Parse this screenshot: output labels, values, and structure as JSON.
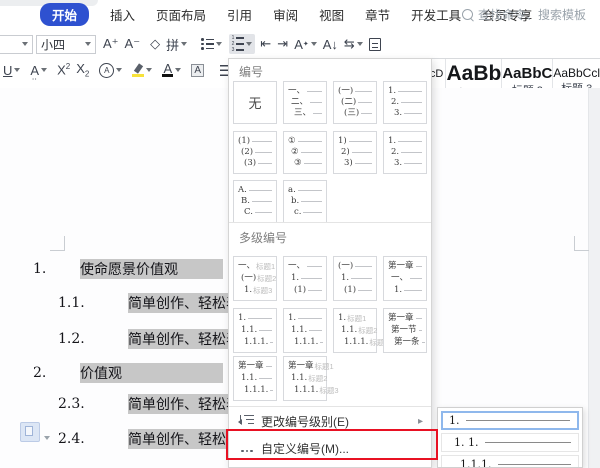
{
  "colors": {
    "accent_blue": "#2e51d0",
    "annotation_red": "#e81123",
    "selection_gray": "#c7c7c7",
    "selected_border_blue": "#8fb8ec",
    "highlighter_yellow": "#f7e23a"
  },
  "tabs": {
    "items": [
      {
        "label": "开始",
        "active": true
      },
      {
        "label": "插入",
        "active": false
      },
      {
        "label": "页面布局",
        "active": false
      },
      {
        "label": "引用",
        "active": false
      },
      {
        "label": "审阅",
        "active": false
      },
      {
        "label": "视图",
        "active": false
      },
      {
        "label": "章节",
        "active": false
      },
      {
        "label": "开发工具",
        "active": false
      },
      {
        "label": "会员专享",
        "active": false
      }
    ],
    "search_placeholder": "查找命令、搜索模板"
  },
  "toolbar": {
    "font_name_value": "",
    "font_size_value": "小四",
    "icons": {
      "font_grow": "A⁺",
      "font_shrink": "A⁻",
      "clear_format": "◇",
      "pinyin_tool": "拼",
      "underline": "U",
      "char_accent": "A",
      "superscript_base": "X",
      "subscript_base": "X",
      "circle_char": "A",
      "font_color": "A",
      "char_shading": "A",
      "text_effects": "A",
      "sort": "A↓",
      "text_direction": "⇆"
    }
  },
  "styles_gallery": [
    {
      "sample": "AaBbCcD",
      "label": ""
    },
    {
      "sample": "AaBb",
      "label": "标题 1"
    },
    {
      "sample": "AaBbC",
      "label": "标题 2"
    },
    {
      "sample": "AaBbCcl",
      "label": "标题 3"
    }
  ],
  "document": {
    "lines": [
      {
        "num": "1.",
        "text": "使命愿景价值观",
        "level": 1
      },
      {
        "num": "1.1.",
        "text": "简单创作、轻松表",
        "level": 2
      },
      {
        "num": "1.2.",
        "text": "简单创作、轻松表",
        "level": 2
      },
      {
        "num": "2.",
        "text": "价值观",
        "level": 1
      },
      {
        "num": "2.3.",
        "text": "简单创作、轻松表",
        "level": 2
      },
      {
        "num": "2.4.",
        "text": "简单创作、轻松表",
        "level": 2
      }
    ]
  },
  "menu": {
    "section_number_title": "编号",
    "section_multilevel_title": "多级编号",
    "none_label": "无",
    "number_cells": [
      {
        "kind": "none"
      },
      {
        "lines": [
          [
            "一、"
          ],
          [
            "二、"
          ],
          [
            "三、"
          ]
        ],
        "dash": true
      },
      {
        "lines": [
          [
            "(一)"
          ],
          [
            "(二)"
          ],
          [
            "(三)"
          ]
        ],
        "dash": true
      },
      {
        "lines": [
          [
            "1."
          ],
          [
            "2."
          ],
          [
            "3."
          ]
        ],
        "dash": true
      },
      {
        "lines": [
          [
            "(1)"
          ],
          [
            "(2)"
          ],
          [
            "(3)"
          ]
        ],
        "dash": true
      },
      {
        "lines": [
          [
            "①"
          ],
          [
            "②"
          ],
          [
            "③"
          ]
        ],
        "dash": true
      },
      {
        "lines": [
          [
            "1)"
          ],
          [
            "2)"
          ],
          [
            "3)"
          ]
        ],
        "dash": true
      },
      {
        "lines": [
          [
            "1."
          ],
          [
            "2."
          ],
          [
            "3."
          ]
        ],
        "dash": true
      },
      {
        "lines": [
          [
            "A."
          ],
          [
            "B."
          ],
          [
            "C."
          ]
        ],
        "dash": true
      },
      {
        "lines": [
          [
            "a."
          ],
          [
            "b."
          ],
          [
            "c."
          ]
        ],
        "dash": true
      }
    ],
    "multilevel_cells": [
      {
        "lines": [
          [
            "一、",
            "标题1"
          ],
          [
            "(一)",
            "标题2"
          ],
          [
            "1.",
            "标题3"
          ]
        ],
        "dash": false
      },
      {
        "lines": [
          [
            "一、"
          ],
          [
            "1."
          ],
          [
            "(1)"
          ]
        ],
        "dash": true
      },
      {
        "lines": [
          [
            "(一)"
          ],
          [
            "1."
          ],
          [
            "(1)"
          ]
        ],
        "dash": true
      },
      {
        "lines": [
          [
            "第一章"
          ],
          [
            "一、"
          ],
          [
            "1."
          ]
        ],
        "dash": true
      },
      {
        "lines": [
          [
            "1."
          ],
          [
            "1.1."
          ],
          [
            "1.1.1."
          ]
        ],
        "dash": true
      },
      {
        "lines": [
          [
            "1."
          ],
          [
            "1.1."
          ],
          [
            "1.1.1."
          ]
        ],
        "dash": true
      },
      {
        "lines": [
          [
            "1.",
            "标题1"
          ],
          [
            "1.1.",
            "标题2"
          ],
          [
            "1.1.1.",
            "标题3"
          ]
        ],
        "dash": false
      },
      {
        "lines": [
          [
            "第一章"
          ],
          [
            "第一节"
          ],
          [
            "第一条"
          ]
        ],
        "dash": true
      },
      {
        "lines": [
          [
            "第一章"
          ],
          [
            "1.1."
          ],
          [
            "1.1.1."
          ]
        ],
        "dash": true
      },
      {
        "lines": [
          [
            "第一章",
            "标题1"
          ],
          [
            "1.1.",
            "标题2"
          ],
          [
            "1.1.1.",
            "标题3"
          ]
        ],
        "dash": false
      }
    ],
    "change_level_label": "更改编号级别(E)",
    "customize_label": "自定义编号(M)..."
  },
  "flyout": {
    "items": [
      {
        "num": "1.",
        "selected": true
      },
      {
        "num": "1. 1.",
        "selected": false
      },
      {
        "num": "1.1.1.",
        "selected": false
      }
    ]
  }
}
